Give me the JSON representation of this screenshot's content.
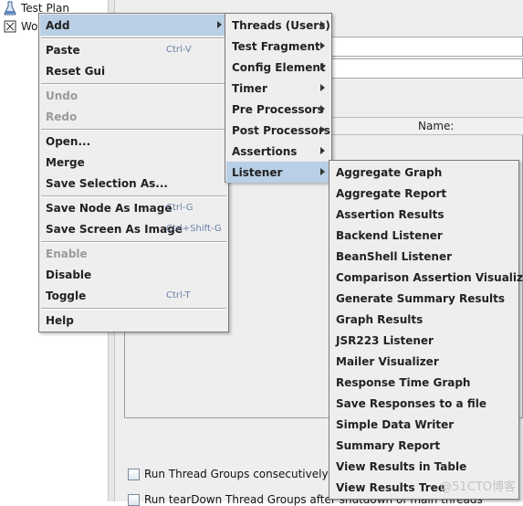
{
  "tree": {
    "items": [
      {
        "label": "Test Plan",
        "icon": "flask-icon"
      },
      {
        "label": "Wo",
        "icon": "workbench-icon"
      }
    ]
  },
  "right_pane": {
    "name_header": "Name:",
    "options": [
      {
        "label": "Run Thread Groups consecutively (i."
      },
      {
        "label": "Run tearDown Thread Groups after shutdown of main threads"
      }
    ]
  },
  "context_menu": {
    "items": [
      {
        "label": "Add",
        "shortcut": "",
        "submenu": true,
        "selected": true,
        "disabled": false
      },
      {
        "label": "Paste",
        "shortcut": "Ctrl-V",
        "disabled": false
      },
      {
        "label": "Reset Gui",
        "shortcut": "",
        "disabled": false
      },
      {
        "label": "Undo",
        "shortcut": "",
        "disabled": true
      },
      {
        "label": "Redo",
        "shortcut": "",
        "disabled": true
      },
      {
        "label": "Open...",
        "shortcut": "",
        "disabled": false
      },
      {
        "label": "Merge",
        "shortcut": "",
        "disabled": false
      },
      {
        "label": "Save Selection As...",
        "shortcut": "",
        "disabled": false
      },
      {
        "label": "Save Node As Image",
        "shortcut": "Ctrl-G",
        "disabled": false
      },
      {
        "label": "Save Screen As Image",
        "shortcut": "Ctrl+Shift-G",
        "disabled": false
      },
      {
        "label": "Enable",
        "shortcut": "",
        "disabled": true
      },
      {
        "label": "Disable",
        "shortcut": "",
        "disabled": false
      },
      {
        "label": "Toggle",
        "shortcut": "Ctrl-T",
        "disabled": false
      },
      {
        "label": "Help",
        "shortcut": "",
        "disabled": false
      }
    ]
  },
  "add_menu": {
    "items": [
      {
        "label": "Threads (Users)"
      },
      {
        "label": "Test Fragment"
      },
      {
        "label": "Config Element"
      },
      {
        "label": "Timer"
      },
      {
        "label": "Pre Processors"
      },
      {
        "label": "Post Processors"
      },
      {
        "label": "Assertions"
      },
      {
        "label": "Listener",
        "selected": true
      }
    ]
  },
  "listener_menu": {
    "items": [
      {
        "label": "Aggregate Graph"
      },
      {
        "label": "Aggregate Report"
      },
      {
        "label": "Assertion Results"
      },
      {
        "label": "Backend Listener"
      },
      {
        "label": "BeanShell Listener"
      },
      {
        "label": "Comparison Assertion Visualizer"
      },
      {
        "label": "Generate Summary Results"
      },
      {
        "label": "Graph Results"
      },
      {
        "label": "JSR223 Listener"
      },
      {
        "label": "Mailer Visualizer"
      },
      {
        "label": "Response Time Graph"
      },
      {
        "label": "Save Responses to a file"
      },
      {
        "label": "Simple Data Writer"
      },
      {
        "label": "Summary Report"
      },
      {
        "label": "View Results in Table"
      },
      {
        "label": "View Results Tree"
      }
    ]
  },
  "watermark": "@51CTO博客",
  "colors": {
    "menu_bg": "#eeeeee",
    "selected_bg": "#b8cfe5",
    "shortcut": "#6a7fa4",
    "disabled_text": "#9a9a9a"
  }
}
